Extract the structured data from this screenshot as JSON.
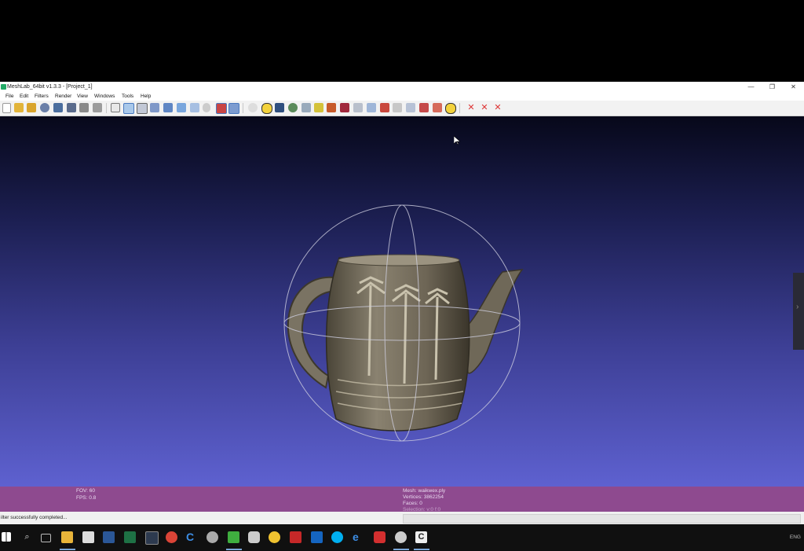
{
  "window": {
    "title": "MeshLab_64bit v1.3.3 - [Project_1]",
    "controls": {
      "minimize": "—",
      "maximize": "❐",
      "close": "✕"
    }
  },
  "menu": {
    "items": [
      "File",
      "Edit",
      "Filters",
      "Render",
      "View",
      "Windows",
      "Tools",
      "Help"
    ]
  },
  "toolbar": {
    "icons": [
      "new-icon",
      "open-icon",
      "open-project-icon",
      "reload-icon",
      "import-icon",
      "save-icon",
      "snapshot-icon",
      "print-icon",
      "bbox-icon",
      "points-icon",
      "wireframe-icon",
      "hidden-lines-icon",
      "flat-icon",
      "smooth-icon",
      "texture-icon",
      "light-icon",
      "color-icon",
      "layers-icon",
      "trackball-icon",
      "annotate-icon",
      "measure-icon",
      "paint-icon",
      "select-faces-icon",
      "select-vertices-icon",
      "pick-points-icon",
      "align-icon",
      "info-icon",
      "delete-icon"
    ]
  },
  "viewport": {
    "side_tab_arrow": "›"
  },
  "info_bar": {
    "fov": "FOV: 60",
    "fps": "FPS:    0.8",
    "mesh": "Mesh: waikwex.ply",
    "vertices": "Vertices: 3862254",
    "faces": "Faces: 0",
    "selection": "Selection: v:0 f:0"
  },
  "status": {
    "message": "ilter successfully completed..."
  },
  "taskbar": {
    "tray_text": "ENG"
  },
  "colors": {
    "viewport_top": "#07081a",
    "viewport_bottom": "#5e61d0",
    "info_bar": "#8e4a8f"
  }
}
